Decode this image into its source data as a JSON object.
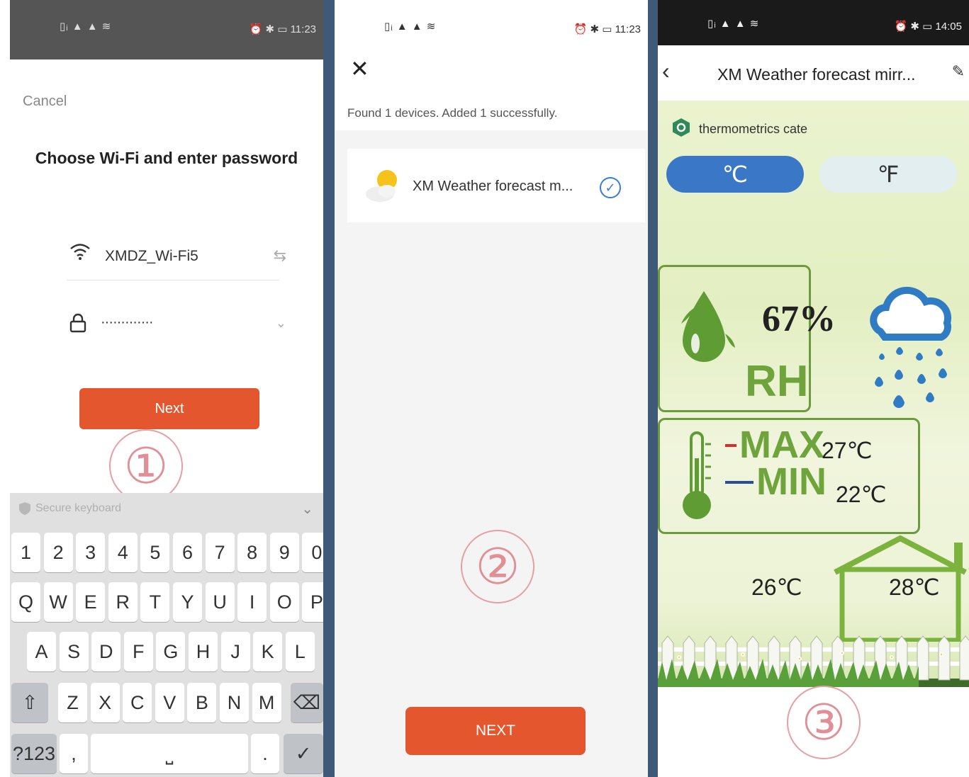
{
  "screen1": {
    "status_signal": "▯ᵢ ▲ ▲ ≋",
    "status_right": "⏰ ✱ ▭ 11:23",
    "cancel_label": "Cancel",
    "title": "Choose Wi-Fi and enter password",
    "wifi_ssid": "XMDZ_Wi-Fi5",
    "password_mask": "·············",
    "next_label": "Next",
    "step_number": "①",
    "keyboard": {
      "secure_label": "Secure keyboard",
      "row1": [
        "1",
        "2",
        "3",
        "4",
        "5",
        "6",
        "7",
        "8",
        "9",
        "0"
      ],
      "row2": [
        "Q",
        "W",
        "E",
        "R",
        "T",
        "Y",
        "U",
        "I",
        "O",
        "P"
      ],
      "row3": [
        "A",
        "S",
        "D",
        "F",
        "G",
        "H",
        "J",
        "K",
        "L"
      ],
      "row4": [
        "Z",
        "X",
        "C",
        "V",
        "B",
        "N",
        "M"
      ],
      "mode_key": "?123",
      "comma_key": ",",
      "period_key": "."
    }
  },
  "screen2": {
    "status_signal": "▯ᵢ ▲ ▲ ≋",
    "status_right": "⏰ ✱ ▭ 11:23",
    "found_text": "Found 1 devices. Added 1 successfully.",
    "device_name": "XM Weather forecast m...",
    "step_number": "②",
    "next_label": "NEXT"
  },
  "screen3": {
    "status_signal": "▯ᵢ ▲ ▲ ≋",
    "status_right": "⏰ ✱ ▭ 14:05",
    "title": "XM Weather forecast mirr...",
    "tag_text": "thermometrics cate",
    "unit_c": "℃",
    "unit_f": "℉",
    "humidity": "67%",
    "humidity_label": "RH",
    "max_label": "MAX",
    "max_value": "27℃",
    "min_label": "MIN",
    "min_value": "22℃",
    "outdoor_temp": "26℃",
    "indoor_temp": "28℃",
    "step_number": "③"
  },
  "colors": {
    "accent_orange": "#e4562d",
    "celsius_blue": "#3a78c7",
    "green": "#6ea43b",
    "rain_blue": "#2f7bc4"
  }
}
